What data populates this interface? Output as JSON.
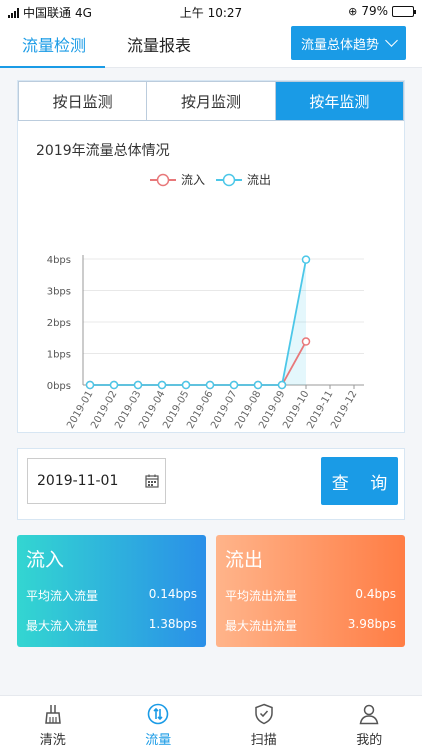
{
  "status_bar": {
    "carrier": "中国联通",
    "network": "4G",
    "time": "上午 10:27",
    "battery": "79%",
    "battery_level": 0.79
  },
  "header": {
    "tabs": [
      {
        "label": "流量检测",
        "active": true
      },
      {
        "label": "流量报表",
        "active": false
      }
    ],
    "trend_dropdown": "流量总体趋势"
  },
  "period_tabs": [
    {
      "label": "按日监测",
      "active": false
    },
    {
      "label": "按月监测",
      "active": false
    },
    {
      "label": "按年监测",
      "active": true
    }
  ],
  "chart_data": {
    "type": "line",
    "title": "2019年流量总体情况",
    "categories": [
      "2019-01",
      "2019-02",
      "2019-03",
      "2019-04",
      "2019-05",
      "2019-06",
      "2019-07",
      "2019-08",
      "2019-09",
      "2019-10",
      "2019-11",
      "2019-12"
    ],
    "y_tick_labels": [
      "0bps",
      "1bps",
      "2bps",
      "3bps",
      "4bps"
    ],
    "ylim": [
      0,
      4
    ],
    "legend_position": "top",
    "series": [
      {
        "name": "流入",
        "color": "#e8787a",
        "values": [
          0,
          0,
          0,
          0,
          0,
          0,
          0,
          0,
          0,
          1.38,
          null,
          null
        ]
      },
      {
        "name": "流出",
        "color": "#4cc7e8",
        "values": [
          0,
          0,
          0,
          0,
          0,
          0,
          0,
          0,
          0,
          3.98,
          null,
          null
        ]
      }
    ]
  },
  "query": {
    "date": "2019-11-01",
    "button": "查 询"
  },
  "stats": {
    "inflow": {
      "title": "流入",
      "avg_label": "平均流入流量",
      "avg_value": "0.14bps",
      "max_label": "最大流入流量",
      "max_value": "1.38bps"
    },
    "outflow": {
      "title": "流出",
      "avg_label": "平均流出流量",
      "avg_value": "0.4bps",
      "max_label": "最大流出流量",
      "max_value": "3.98bps"
    }
  },
  "tabbar": [
    {
      "label": "清洗",
      "icon": "broom-icon",
      "active": false
    },
    {
      "label": "流量",
      "icon": "traffic-icon",
      "active": true
    },
    {
      "label": "扫描",
      "icon": "shield-check-icon",
      "active": false
    },
    {
      "label": "我的",
      "icon": "user-icon",
      "active": false
    }
  ],
  "colors": {
    "accent": "#1a9be6",
    "inflow": "#e8787a",
    "outflow": "#4cc7e8"
  }
}
